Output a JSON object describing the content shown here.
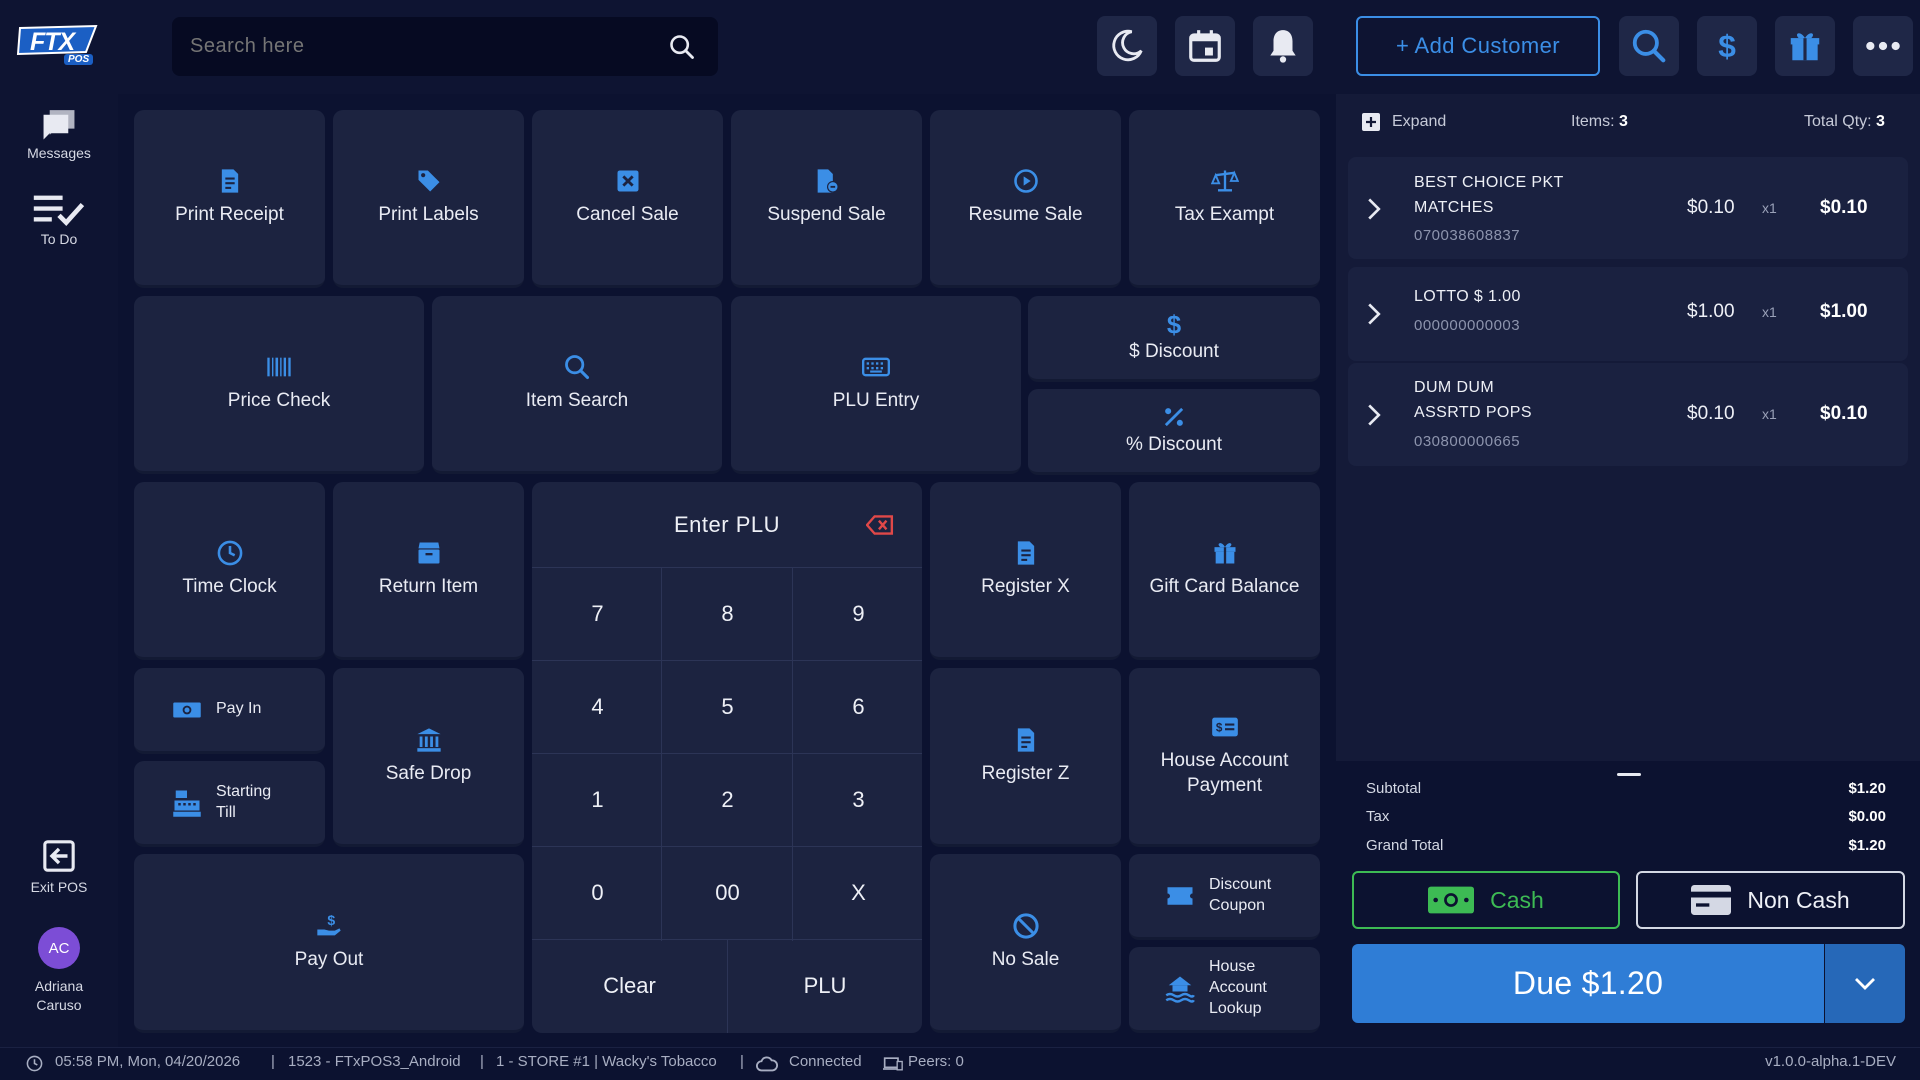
{
  "logo": {
    "text": "FTX",
    "sub": "POS"
  },
  "search": {
    "placeholder": "Search here"
  },
  "header": {
    "add_customer": "+ Add Customer"
  },
  "sidebar": {
    "messages": "Messages",
    "todo": "To Do",
    "exit": "Exit POS",
    "user_initials": "AC",
    "user_first": "Adriana",
    "user_last": "Caruso"
  },
  "tiles": {
    "print_receipt": "Print Receipt",
    "print_labels": "Print Labels",
    "cancel_sale": "Cancel Sale",
    "suspend_sale": "Suspend Sale",
    "resume_sale": "Resume Sale",
    "tax_exempt": "Tax Exampt",
    "price_check": "Price Check",
    "item_search": "Item Search",
    "plu_entry": "PLU Entry",
    "dollar_discount": "$ Discount",
    "percent_discount": "% Discount",
    "time_clock": "Time Clock",
    "return_item": "Return Item",
    "register_x": "Register X",
    "gift_card_balance": "Gift Card Balance",
    "pay_in": "Pay In",
    "starting_till_1": "Starting",
    "starting_till_2": "Till",
    "safe_drop": "Safe Drop",
    "register_z": "Register Z",
    "house_account_payment_1": "House Account",
    "house_account_payment_2": "Payment",
    "pay_out": "Pay Out",
    "no_sale": "No Sale",
    "discount_coupon_1": "Discount",
    "discount_coupon_2": "Coupon",
    "house_account_lookup_1": "House",
    "house_account_lookup_2": "Account",
    "house_account_lookup_3": "Lookup"
  },
  "keypad": {
    "title": "Enter PLU",
    "keys": [
      "7",
      "8",
      "9",
      "4",
      "5",
      "6",
      "1",
      "2",
      "3",
      "0",
      "00",
      "X"
    ],
    "clear": "Clear",
    "plu": "PLU"
  },
  "cart": {
    "expand": "Expand",
    "items_label": "Items:",
    "items_count": "3",
    "qty_label": "Total Qty:",
    "qty_count": "3",
    "items": [
      {
        "name1": "BEST CHOICE PKT",
        "name2": "MATCHES",
        "code": "070038608837",
        "price": "$0.10",
        "qty": "x1",
        "total": "$0.10"
      },
      {
        "name1": "LOTTO $ 1.00",
        "name2": "",
        "code": "000000000003",
        "price": "$1.00",
        "qty": "x1",
        "total": "$1.00"
      },
      {
        "name1": "DUM DUM",
        "name2": "ASSRTD POPS",
        "code": "030800000665",
        "price": "$0.10",
        "qty": "x1",
        "total": "$0.10"
      }
    ]
  },
  "summary": {
    "subtotal_label": "Subtotal",
    "subtotal": "$1.20",
    "tax_label": "Tax",
    "tax": "$0.00",
    "grand_label": "Grand Total",
    "grand": "$1.20"
  },
  "payment": {
    "cash": "Cash",
    "non_cash": "Non Cash",
    "due": "Due $1.20"
  },
  "status": {
    "time": "05:58 PM, Mon, 04/20/2026",
    "terminal": "1523 - FTxPOS3_Android",
    "store": "1 - STORE #1 | Wacky's Tobacco",
    "connection": "Connected",
    "peers": "Peers: 0",
    "version": "v1.0.0-alpha.1-DEV"
  },
  "colors": {
    "accent": "#3b8ee6",
    "background": "#0c1230",
    "tile": "#1c2340",
    "cash_green": "#3dbb54",
    "due_blue": "#2f7dd6"
  }
}
